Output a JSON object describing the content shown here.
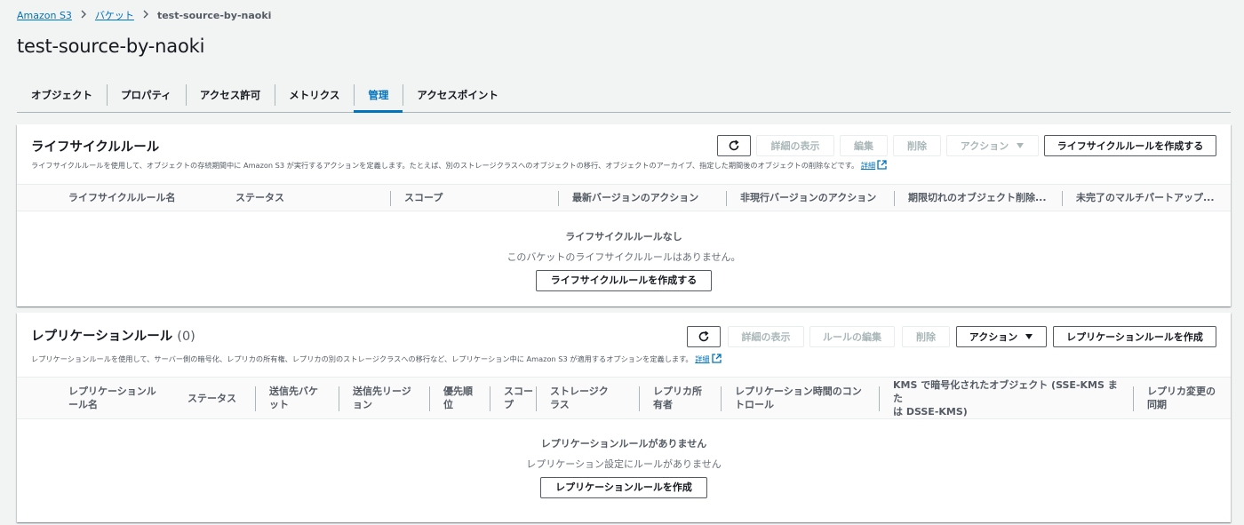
{
  "breadcrumb": {
    "items": [
      "Amazon S3",
      "バケット"
    ],
    "current": "test-source-by-naoki"
  },
  "page": {
    "title": "test-source-by-naoki"
  },
  "tabs": [
    "オブジェクト",
    "プロパティ",
    "アクセス許可",
    "メトリクス",
    "管理",
    "アクセスポイント"
  ],
  "active_tab": "管理",
  "lifecycle": {
    "title": "ライフサイクルルール",
    "description": "ライフサイクルルールを使用して、オブジェクトの存続期間中に Amazon S3 が実行するアクションを定義します。たとえば、別のストレージクラスへのオブジェクトの移行、オブジェクトのアーカイブ、指定した期間後のオブジェクトの削除などです。",
    "info_link": "詳細",
    "buttons": {
      "details": "詳細の表示",
      "edit": "編集",
      "delete": "削除",
      "actions": "アクション",
      "create": "ライフサイクルルールを作成する"
    },
    "columns": [
      "ライフサイクルルール名",
      "ステータス",
      "スコープ",
      "最新バージョンのアクション",
      "非現行バージョンのアクション",
      "期限切れのオブジェクト削除...",
      "未完了のマルチパートアップ..."
    ],
    "empty_title": "ライフサイクルルールなし",
    "empty_desc": "このバケットのライフサイクルルールはありません。",
    "empty_button": "ライフサイクルルールを作成する"
  },
  "replication": {
    "title": "レプリケーションルール",
    "count": "(0)",
    "description": "レプリケーションルールを使用して、サーバー側の暗号化、レプリカの所有権、レプリカの別のストレージクラスへの移行など、レプリケーション中に Amazon S3 が適用するオプションを定義します。",
    "info_link": "詳細",
    "buttons": {
      "details": "詳細の表示",
      "edit": "ルールの編集",
      "delete": "削除",
      "actions": "アクション",
      "create": "レプリケーションルールを作成"
    },
    "columns": [
      "レプリケーションル\nール名",
      "ステータス",
      "送信先バケ\nット",
      "送信先リージ\nョン",
      "優先順\n位",
      "スコー\nプ",
      "ストレージク\nラス",
      "レプリカ所\n有者",
      "レプリケーション時間のコン\nトロール",
      "KMS で暗号化されたオブジェクト (SSE-KMS また\nは DSSE-KMS)",
      "レプリカ変更の\n同期"
    ],
    "empty_title": "レプリケーションルールがありません",
    "empty_desc": "レプリケーション設定にルールがありません",
    "empty_button": "レプリケーションルールを作成"
  }
}
